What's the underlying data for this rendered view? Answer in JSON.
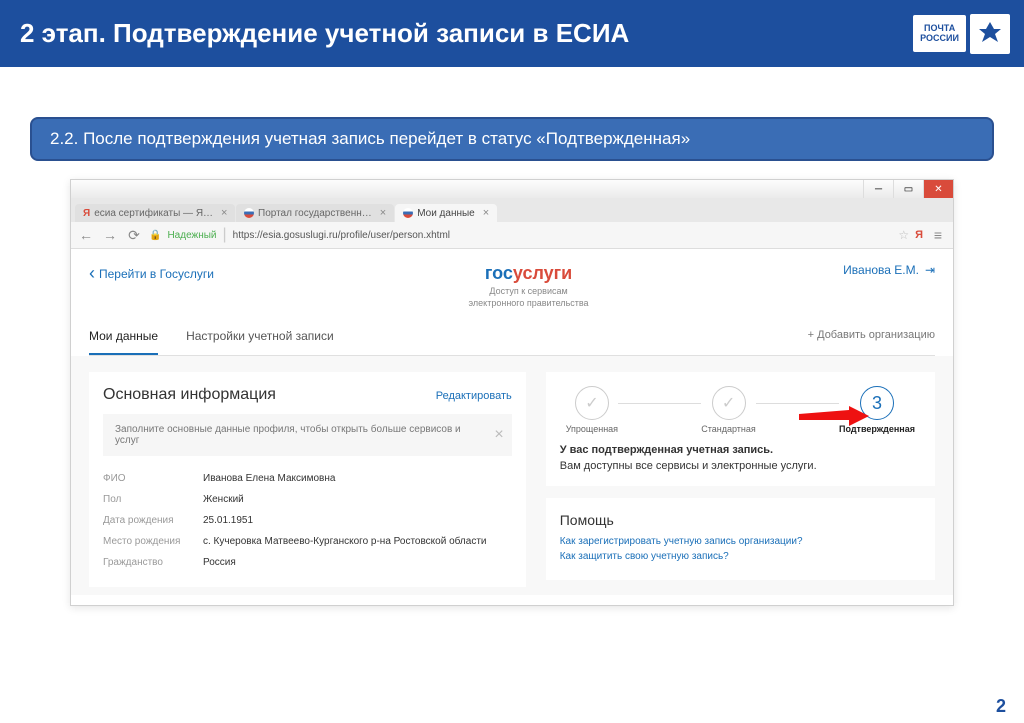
{
  "slide": {
    "title": "2 этап. Подтверждение учетной записи в ЕСИА",
    "logo_line1": "ПОЧТА",
    "logo_line2": "РОССИИ",
    "subtitle": "2.2. После подтверждения учетная запись перейдет в статус «Подтвержденная»",
    "page_num": "2"
  },
  "browser": {
    "tabs": [
      {
        "label": "есиа сертификаты — Я…"
      },
      {
        "label": "Портал государственн…"
      },
      {
        "label": "Мои данные"
      }
    ],
    "secure": "Надежный",
    "url": "https://esia.gosuslugi.ru/profile/user/person.xhtml"
  },
  "page": {
    "back": "Перейти в Госуслуги",
    "logo_sub": "Доступ к сервисам\nэлектронного правительства",
    "user": "Иванова Е.М.",
    "tabs": [
      "Мои данные",
      "Настройки учетной записи"
    ],
    "add_org": "+ Добавить организацию"
  },
  "info": {
    "title": "Основная информация",
    "edit": "Редактировать",
    "banner": "Заполните основные данные профиля, чтобы открыть больше сервисов и услуг",
    "fields": [
      {
        "label": "ФИО",
        "value": "Иванова Елена Максимовна"
      },
      {
        "label": "Пол",
        "value": "Женский"
      },
      {
        "label": "Дата рождения",
        "value": "25.01.1951"
      },
      {
        "label": "Место рождения",
        "value": "с. Кучеровка Матвеево-Курганского р-на Ростовской области"
      },
      {
        "label": "Гражданство",
        "value": "Россия"
      }
    ]
  },
  "status": {
    "steps": [
      "Упрощенная",
      "Стандартная",
      "Подтвержденная"
    ],
    "step3_num": "3",
    "bold": "У вас подтвержденная учетная запись.",
    "text": "Вам доступны все сервисы и электронные услуги."
  },
  "help": {
    "title": "Помощь",
    "links": [
      "Как зарегистрировать учетную запись организации?",
      "Как защитить свою учетную запись?"
    ]
  }
}
